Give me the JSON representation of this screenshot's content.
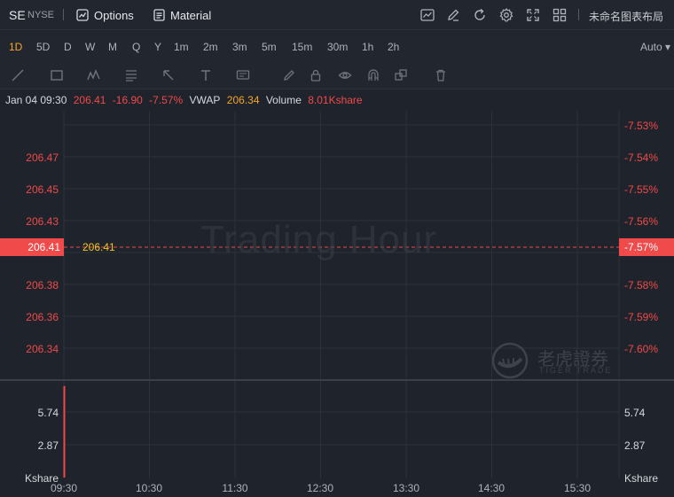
{
  "header": {
    "symbol": "SE",
    "exchange": "NYSE",
    "options_label": "Options",
    "material_label": "Material",
    "layout_name": "未命名图表布局"
  },
  "timeframes": {
    "items": [
      "1D",
      "5D",
      "D",
      "W",
      "M",
      "Q",
      "Y",
      "1m",
      "2m",
      "3m",
      "5m",
      "15m",
      "30m",
      "1h",
      "2h"
    ],
    "active": "1D",
    "scale_mode": "Auto"
  },
  "info": {
    "datetime": "Jan 04 09:30",
    "price": "206.41",
    "change": "-16.90",
    "change_pct": "-7.57%",
    "vwap_label": "VWAP",
    "vwap": "206.34",
    "volume_label": "Volume",
    "volume": "8.01Kshare"
  },
  "chart_data": {
    "type": "line",
    "price_axis_left": [
      "206.47",
      "206.45",
      "206.43",
      "206.41",
      "206.38",
      "206.36",
      "206.34"
    ],
    "price_axis_right": [
      "-7.53%",
      "-7.54%",
      "-7.55%",
      "-7.56%",
      "-7.57%",
      "-7.58%",
      "-7.59%",
      "-7.60%"
    ],
    "current_price": "206.41",
    "current_pct": "-7.57%",
    "volume_axis": [
      "5.74",
      "2.87"
    ],
    "volume_unit": "Kshare",
    "volume_max": 8.01,
    "x_ticks": [
      "09:30",
      "10:30",
      "11:30",
      "12:30",
      "13:30",
      "14:30",
      "15:30"
    ],
    "watermark": "Trading Hour",
    "colors": {
      "down": "#f04a4a",
      "vwap": "#f5a623",
      "grid": "#2c313a"
    }
  },
  "brand": {
    "cn": "老虎證券",
    "en": "TIGER TRADE"
  }
}
